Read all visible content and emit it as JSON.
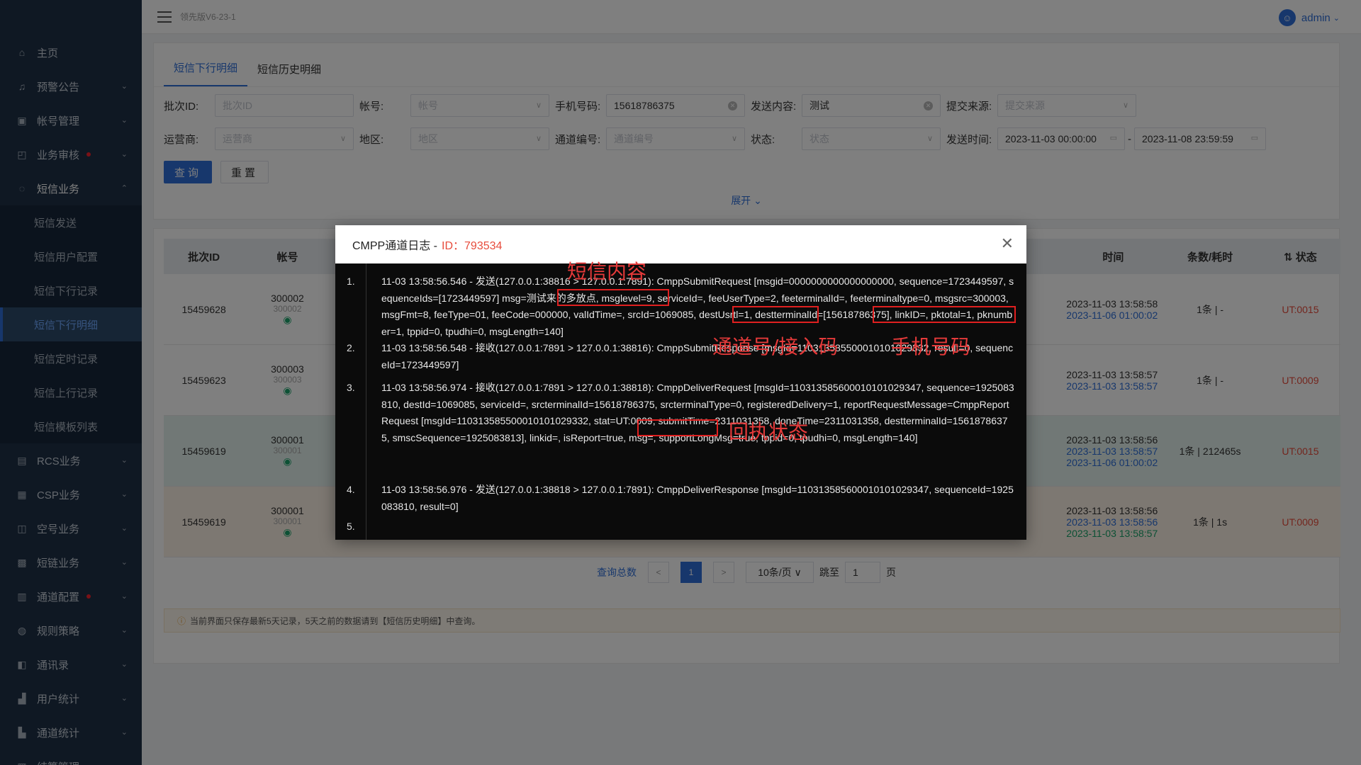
{
  "header": {
    "version": "领先版V6-23-1",
    "user": "admin"
  },
  "sidebar": {
    "items": [
      {
        "label": "主页",
        "icon": "home-icon",
        "chevron": false,
        "dot": false
      },
      {
        "label": "预警公告",
        "icon": "bell-icon",
        "chevron": true,
        "dot": false
      },
      {
        "label": "帐号管理",
        "icon": "account-icon",
        "chevron": true,
        "dot": false
      },
      {
        "label": "业务审核",
        "icon": "audit-icon",
        "chevron": true,
        "dot": true
      },
      {
        "label": "短信业务",
        "icon": "message-icon",
        "chevron": true,
        "dot": false,
        "open": true
      }
    ],
    "sub_items": [
      "短信发送",
      "短信用户配置",
      "短信下行记录",
      "短信下行明细",
      "短信定时记录",
      "短信上行记录",
      "短信模板列表"
    ],
    "active_sub": "短信下行明细",
    "items_after": [
      {
        "label": "RCS业务",
        "icon": "rcs-icon",
        "dot": false
      },
      {
        "label": "CSP业务",
        "icon": "csp-icon",
        "dot": false
      },
      {
        "label": "空号业务",
        "icon": "empty-number-icon",
        "dot": false
      },
      {
        "label": "短链业务",
        "icon": "short-link-icon",
        "dot": false
      },
      {
        "label": "通道配置",
        "icon": "channel-config-icon",
        "dot": true
      },
      {
        "label": "规则策略",
        "icon": "rule-icon",
        "dot": false
      },
      {
        "label": "通讯录",
        "icon": "contacts-icon",
        "dot": false
      },
      {
        "label": "用户统计",
        "icon": "user-stats-icon",
        "dot": false
      },
      {
        "label": "通道统计",
        "icon": "channel-stats-icon",
        "dot": false
      },
      {
        "label": "结算管理",
        "icon": "settlement-icon",
        "dot": false
      }
    ]
  },
  "tabs": [
    "短信下行明细",
    "短信历史明细"
  ],
  "filters": {
    "batch_id": {
      "label": "批次ID:",
      "placeholder": "批次ID"
    },
    "account": {
      "label": "帐号:",
      "placeholder": "帐号"
    },
    "phone": {
      "label": "手机号码:",
      "value": "15618786375"
    },
    "content": {
      "label": "发送内容:",
      "value": "测试"
    },
    "source": {
      "label": "提交来源:",
      "placeholder": "提交来源"
    },
    "operator": {
      "label": "运营商:",
      "placeholder": "运营商"
    },
    "region": {
      "label": "地区:",
      "placeholder": "地区"
    },
    "channel": {
      "label": "通道编号:",
      "placeholder": "通道编号"
    },
    "status": {
      "label": "状态:",
      "placeholder": "状态"
    },
    "time": {
      "label": "发送时间:",
      "start": "2023-11-03 00:00:00",
      "sep": "-",
      "end": "2023-11-08 23:59:59"
    },
    "query_btn": "查询",
    "reset_btn": "重置",
    "expand": "展开 ⌄"
  },
  "table": {
    "headers": [
      "批次ID",
      "帐号",
      "时间",
      "条数/耗时",
      "状态"
    ],
    "rows": [
      {
        "batch": "15459628",
        "account": "300002",
        "sub": "300002",
        "times": [
          "2023-11-03 13:58:58",
          "2023-11-06 01:00:02"
        ],
        "count": "1条",
        "cost": "-",
        "status": "UT:0015"
      },
      {
        "batch": "15459623",
        "account": "300003",
        "sub": "300003",
        "times": [
          "2023-11-03 13:58:57",
          "2023-11-03 13:58:57"
        ],
        "count": "1条",
        "cost": "-",
        "status": "UT:0009"
      },
      {
        "batch": "15459619",
        "account": "300001",
        "sub": "300001",
        "times": [
          "2023-11-03 13:58:56",
          "2023-11-03 13:58:57",
          "2023-11-06 01:00:02"
        ],
        "count": "1条",
        "cost": "212465s",
        "status": "UT:0015"
      },
      {
        "batch": "15459619",
        "account": "300001",
        "sub": "300001",
        "times": [
          "2023-11-03 13:58:56",
          "2023-11-03 13:58:56",
          "2023-11-03 13:58:57"
        ],
        "count": "1条",
        "cost": "1s",
        "status": "UT:0009"
      }
    ]
  },
  "pager": {
    "total_label": "查询总数",
    "current": "1",
    "page_size": "10条/页",
    "jump_label": "跳至",
    "jump_value": "1",
    "page_unit": "页"
  },
  "note": "当前界面只保存最新5天记录，5天之前的数据请到【短信历史明细】中查询。",
  "dialog": {
    "title": "CMPP通道日志 - ",
    "id_label": "ID：793534",
    "lines": [
      {
        "num": "1.",
        "text": "11-03 13:58:56.546 - 发送(127.0.0.1:38816 > 127.0.0.1:7891): CmppSubmitRequest [msgid=0000000000000000000, sequence=1723449597, sequenceIds=[1723449597] msg=测试来的多放点, msglevel=9, serviceId=, feeUserType=2, feeterminalId=, feeterminaltype=0, msgsrc=300003, msgFmt=8, feeType=01, feeCode=000000, valIdTime=, srcId=1069085, destUsrtl=1, destterminalId=[15618786375], linkID=, pktotal=1, pknumber=1, tppid=0, tpudhi=0, msgLength=140]"
      },
      {
        "num": "2.",
        "text": "11-03 13:58:56.548 - 接收(127.0.0.1:7891 > 127.0.0.1:38816): CmppSubmitResponse [msgId=110313585500010101029332, result=0, sequenceId=1723449597]"
      },
      {
        "num": "3.",
        "text": "11-03 13:58:56.974 - 接收(127.0.0.1:7891 > 127.0.0.1:38818): CmppDeliverRequest [msgId=110313585600010101029347, sequence=1925083810, destId=1069085, serviceId=, srcterminalId=15618786375, srcterminalType=0, registeredDelivery=1, reportRequestMessage=CmppReportRequest [msgId=110313585500010101029332, stat=UT:0009, submitTime=2311031358, doneTime=2311031358, destterminalId=15618786375, smscSequence=1925083813], linkid=, isReport=true, msg=, supportLongMsg=true, tppid=0, tpudhi=0, msgLength=140]"
      },
      {
        "num": "4.",
        "text": "11-03 13:58:56.976 - 发送(127.0.0.1:38818 > 127.0.0.1:7891): CmppDeliverResponse [msgId=110313585600010101029347, sequenceId=1925083810, result=0]"
      },
      {
        "num": "5.",
        "text": ""
      }
    ],
    "annotations": {
      "sms_content": "短信内容",
      "channel_code": "通道号/接入码",
      "phone": "手机号码",
      "receipt_status": "回执状态"
    }
  }
}
